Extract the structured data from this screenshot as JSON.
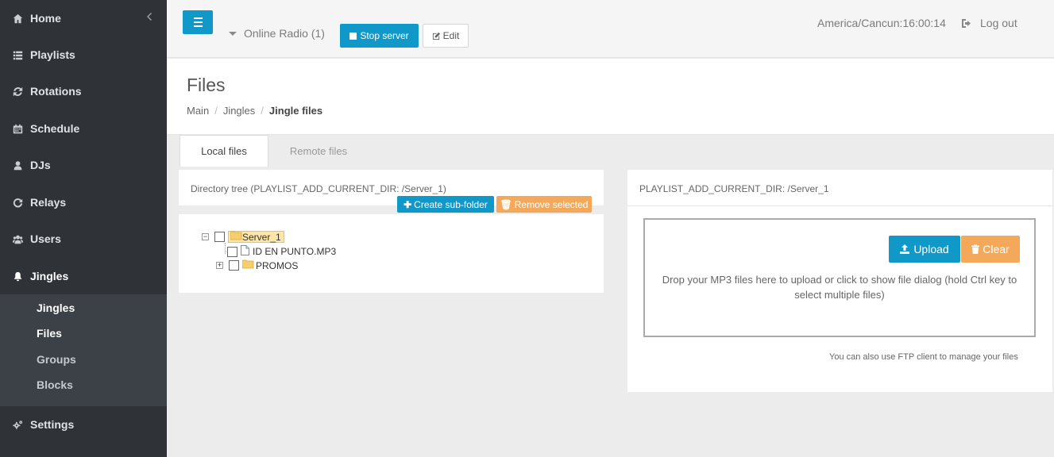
{
  "sidebar": {
    "items": [
      {
        "label": "Home",
        "icon": "home-icon"
      },
      {
        "label": "Playlists",
        "icon": "list-icon"
      },
      {
        "label": "Rotations",
        "icon": "refresh-icon"
      },
      {
        "label": "Schedule",
        "icon": "calendar-icon"
      },
      {
        "label": "DJs",
        "icon": "user-icon"
      },
      {
        "label": "Relays",
        "icon": "rotate-icon"
      },
      {
        "label": "Users",
        "icon": "users-icon"
      },
      {
        "label": "Jingles",
        "icon": "bell-icon"
      },
      {
        "label": "Settings",
        "icon": "gears-icon"
      }
    ],
    "submenu": [
      "Jingles",
      "Files",
      "Groups",
      "Blocks"
    ]
  },
  "topbar": {
    "radio_label": "Online Radio (1)",
    "stop_label": "Stop server",
    "edit_label": "Edit",
    "clock": "America/Cancun:16:00:14",
    "logout_label": "Log out"
  },
  "page": {
    "title": "Files",
    "breadcrumb": [
      "Main",
      "Jingles",
      "Jingle files"
    ]
  },
  "tabs": {
    "local": "Local files",
    "remote": "Remote files"
  },
  "left_panel": {
    "title": "Directory tree (PLAYLIST_ADD_CURRENT_DIR: /Server_1)",
    "create_label": "Create sub-folder",
    "remove_label": "Remove selected",
    "tree": {
      "root": "Server_1",
      "file": "ID EN PUNTO.MP3",
      "folder": "PROMOS"
    }
  },
  "right_panel": {
    "title": "PLAYLIST_ADD_CURRENT_DIR: /Server_1",
    "upload_label": "Upload",
    "clear_label": "Clear",
    "drop_text": "Drop your MP3 files here to upload or click to show file dialog (hold Ctrl key to select multiple files)",
    "ftp_note": "You can also use FTP client to manage your files"
  },
  "colors": {
    "primary": "#0f98c8",
    "warning": "#f4a85a",
    "sidebar": "#2f3337",
    "submenu": "#3b4147"
  }
}
